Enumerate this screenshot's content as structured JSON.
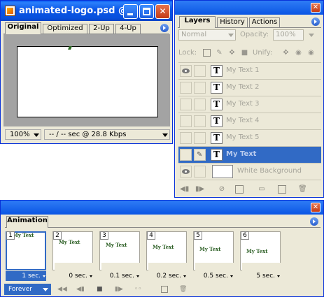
{
  "document_window": {
    "title": "animated-logo.psd @...",
    "tabs": [
      "Original",
      "Optimized",
      "2-Up",
      "4-Up"
    ],
    "active_tab": "Original",
    "zoom": "100%",
    "download_status": "-- / -- sec @ 28.8 Kbps",
    "buttons": {
      "minimize": "",
      "maximize": "",
      "close": "✕"
    }
  },
  "layers_palette": {
    "tabs": [
      "Layers",
      "History",
      "Actions"
    ],
    "active_tab": "Layers",
    "blend_mode": "Normal",
    "opacity_label": "Opacity:",
    "opacity_value": "100%",
    "lock_label": "Lock:",
    "unify_label": "Unify:",
    "layers": [
      {
        "name": "My Text 1",
        "type": "text",
        "visible": true,
        "selected": false
      },
      {
        "name": "My Text 2",
        "type": "text",
        "visible": false,
        "selected": false
      },
      {
        "name": "My Text 3",
        "type": "text",
        "visible": false,
        "selected": false
      },
      {
        "name": "My Text 4",
        "type": "text",
        "visible": false,
        "selected": false
      },
      {
        "name": "My Text 5",
        "type": "text",
        "visible": false,
        "selected": false
      },
      {
        "name": "My Text",
        "type": "text",
        "visible": false,
        "selected": true
      },
      {
        "name": "White Background",
        "type": "image",
        "visible": true,
        "selected": false
      }
    ],
    "close_label": "✕"
  },
  "animation_palette": {
    "tab": "Animation",
    "close_label": "✕",
    "frames": [
      {
        "number": "1",
        "delay": "1 sec.",
        "text": "My Text",
        "selected": true
      },
      {
        "number": "2",
        "delay": "0 sec.",
        "text": "My Text",
        "selected": false
      },
      {
        "number": "3",
        "delay": "0.1 sec.",
        "text": "My Text",
        "selected": false
      },
      {
        "number": "4",
        "delay": "0.2 sec.",
        "text": "My Text",
        "selected": false
      },
      {
        "number": "5",
        "delay": "0.5 sec.",
        "text": "My Text",
        "selected": false
      },
      {
        "number": "6",
        "delay": "5 sec.",
        "text": "My Text",
        "selected": false
      }
    ],
    "loop_option": "Forever"
  },
  "colors": {
    "selection": "#316ac5",
    "frame_text": "#2a5d22",
    "xp_title": "#0a55e4",
    "close_red": "#c43b16"
  }
}
